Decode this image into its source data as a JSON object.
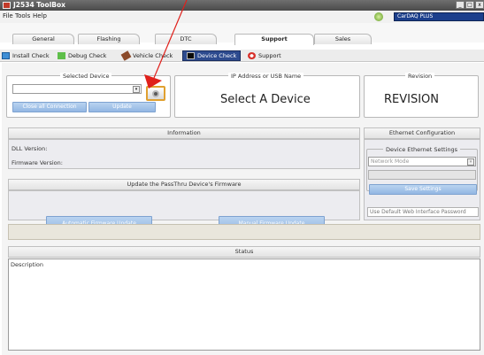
{
  "window": {
    "title": "J2534 ToolBox",
    "buttons": [
      "_",
      "□",
      "x"
    ]
  },
  "menu": {
    "items": [
      "File",
      "Tools",
      "Help"
    ],
    "device_select": "CarDAQ PLUS"
  },
  "main_tabs": [
    {
      "label": "General",
      "active": false
    },
    {
      "label": "Flashing",
      "active": false
    },
    {
      "label": "DTC",
      "active": false
    },
    {
      "label": "Support",
      "active": true
    },
    {
      "label": "Sales",
      "active": false
    }
  ],
  "sub_tabs": [
    {
      "label": "Install Check",
      "icon": "install-check-icon",
      "active": false
    },
    {
      "label": "Debug Check",
      "icon": "debug-check-icon",
      "active": false
    },
    {
      "label": "Vehicle Check",
      "icon": "vehicle-check-icon",
      "active": false
    },
    {
      "label": "Device Check",
      "icon": "device-check-icon",
      "active": true
    },
    {
      "label": "Support",
      "icon": "support-icon",
      "active": false
    }
  ],
  "selected_device": {
    "label": "Selected Device",
    "value": "",
    "close_all_label": "Close all Connection",
    "update_label": "Update"
  },
  "ip_address": {
    "label": "IP Address or USB Name",
    "value": "Select A Device"
  },
  "revision": {
    "label": "Revision",
    "value": "REVISION"
  },
  "information": {
    "header": "Information",
    "dll_version_label": "DLL Version:",
    "firmware_version_label": "Firmware Version:"
  },
  "firmware_update": {
    "header": "Update the PassThru Device's Firmware",
    "automatic_label": "Automatic Firmware Update",
    "manual_label": "Manual Firmware Update"
  },
  "ethernet": {
    "header": "Ethernet Configuration",
    "settings_label": "Device Ethernet Settings",
    "network_mode_placeholder": "Network Mode",
    "save_label": "Save Settings",
    "default_password_label": "Use Default Web Interface Password"
  },
  "status": {
    "header": "Status",
    "description_label": "Description"
  },
  "colors": {
    "accent_blue": "#2d4b8f",
    "button_blue": "#9dbde6",
    "arrow_red": "#e0201b"
  }
}
